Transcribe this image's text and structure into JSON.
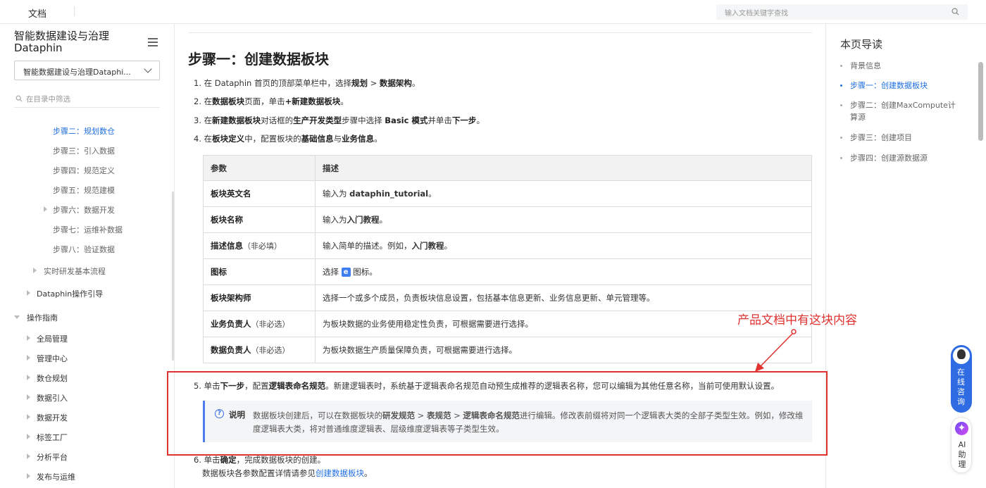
{
  "header": {
    "tab": "文档",
    "search_placeholder": "输入文档关键字查找"
  },
  "sidebar": {
    "product_title": "智能数据建设与治理 Dataphin",
    "product_select": "智能数据建设与治理Dataphi...",
    "filter_placeholder": "在目录中筛选",
    "items": [
      {
        "label": "步骤二：规划数仓",
        "active": true
      },
      {
        "label": "步骤三：引入数据"
      },
      {
        "label": "步骤四：规范定义"
      },
      {
        "label": "步骤五：规范建模"
      },
      {
        "label": "步骤六：数据开发"
      },
      {
        "label": "步骤七：运维补数据"
      },
      {
        "label": "步骤八：验证数据"
      },
      {
        "label": "实时研发基本流程"
      },
      {
        "label": "Dataphin操作引导"
      },
      {
        "label": "操作指南"
      },
      {
        "label": "全局管理"
      },
      {
        "label": "管理中心"
      },
      {
        "label": "数仓规划"
      },
      {
        "label": "数据引入"
      },
      {
        "label": "数据开发"
      },
      {
        "label": "标签工厂"
      },
      {
        "label": "分析平台"
      },
      {
        "label": "发布与运维"
      }
    ]
  },
  "content": {
    "title": "步骤一：创建数据板块",
    "steps": {
      "s1": {
        "a": "1. 在 Dataphin 首页的顶部菜单栏中，选择",
        "b": "规划",
        "c": " > ",
        "d": "数据架构",
        "e": "。"
      },
      "s2": {
        "a": "2. 在",
        "b": "数据板块",
        "c": "页面，单击",
        "d": "+新建数据板块",
        "e": "。"
      },
      "s3": {
        "a": "3. 在",
        "b": "新建数据板块",
        "c": "对话框的",
        "d": "生产开发类型",
        "e": "步骤中选择 ",
        "f": "Basic 模式",
        "g": "并单击",
        "h": "下一步",
        "i": "。"
      },
      "s4": {
        "a": "4. 在",
        "b": "板块定义",
        "c": "中，配置板块的",
        "d": "基础信息",
        "e": "与",
        "f": "业务信息",
        "g": "。"
      },
      "s5": {
        "a": "5. 单击",
        "b": "下一步",
        "c": "，配置",
        "d": "逻辑表命名规范",
        "e": "。新建逻辑表时，系统基于逻辑表命名规范自动预生成推荐的逻辑表名称，您可以编辑为其他任意名称，当前可使用默认设置。"
      },
      "s6": {
        "a": "6. 单击",
        "b": "确定",
        "c": "，完成数据板块的创建。"
      },
      "s7": {
        "a": "数据板块各参数配置详情请参见",
        "link": "创建数据板块",
        "b": "。"
      }
    },
    "table": {
      "headers": [
        "参数",
        "描述"
      ],
      "rows": [
        {
          "k": "板块英文名",
          "k2": "",
          "d1": "输入为 ",
          "d2": "dataphin_tutorial",
          "d3": "。"
        },
        {
          "k": "板块名称",
          "k2": "",
          "d1": "输入为",
          "d2": "入门教程",
          "d3": "。"
        },
        {
          "k": "描述信息",
          "k2": "（非必填）",
          "d1": "输入简单的描述。例如，",
          "d2": "入门教程",
          "d3": "。"
        },
        {
          "k": "图标",
          "k2": "",
          "d1": "选择 ",
          "icon": "e",
          "d3": " 图标。"
        },
        {
          "k": "板块架构师",
          "k2": "",
          "d1": "选择一个或多个成员，负责板块信息设置，包括基本信息更新、业务信息更新、单元管理等。",
          "d2": "",
          "d3": ""
        },
        {
          "k": "业务负责人",
          "k2": "（非必选）",
          "d1": "为板块数据的业务使用稳定性负责，可根据需要进行选择。",
          "d2": "",
          "d3": ""
        },
        {
          "k": "数据负责人",
          "k2": "（非必选）",
          "d1": "为板块数据生产质量保障负责，可根据需要进行选择。",
          "d2": "",
          "d3": ""
        }
      ]
    },
    "note": {
      "label": "说明",
      "t1": "数据板块创建后，可以在数据板块的",
      "t2": "研发规范",
      "t3": " > ",
      "t4": "表规范",
      "t5": " > ",
      "t6": "逻辑表命名规范",
      "t7": "进行编辑。修改表前缀将对同一个逻辑表大类的全部子类型生效。例如，修改维度逻辑表大类，将对普通维度逻辑表、层级维度逻辑表等子类型生效。"
    },
    "annotation": "产品文档中有这块内容"
  },
  "toc": {
    "title": "本页导读",
    "items": [
      {
        "label": "背景信息"
      },
      {
        "label": "步骤一：创建数据板块",
        "active": true
      },
      {
        "label": "步骤二：创建MaxCompute计算源"
      },
      {
        "label": "步骤三：创建项目"
      },
      {
        "label": "步骤四：创建源数据源"
      }
    ]
  },
  "float": {
    "consult": "在线咨询",
    "ai": "AI助理"
  },
  "colors": {
    "accent": "#1f6fe0",
    "annotation": "#e0322f"
  }
}
